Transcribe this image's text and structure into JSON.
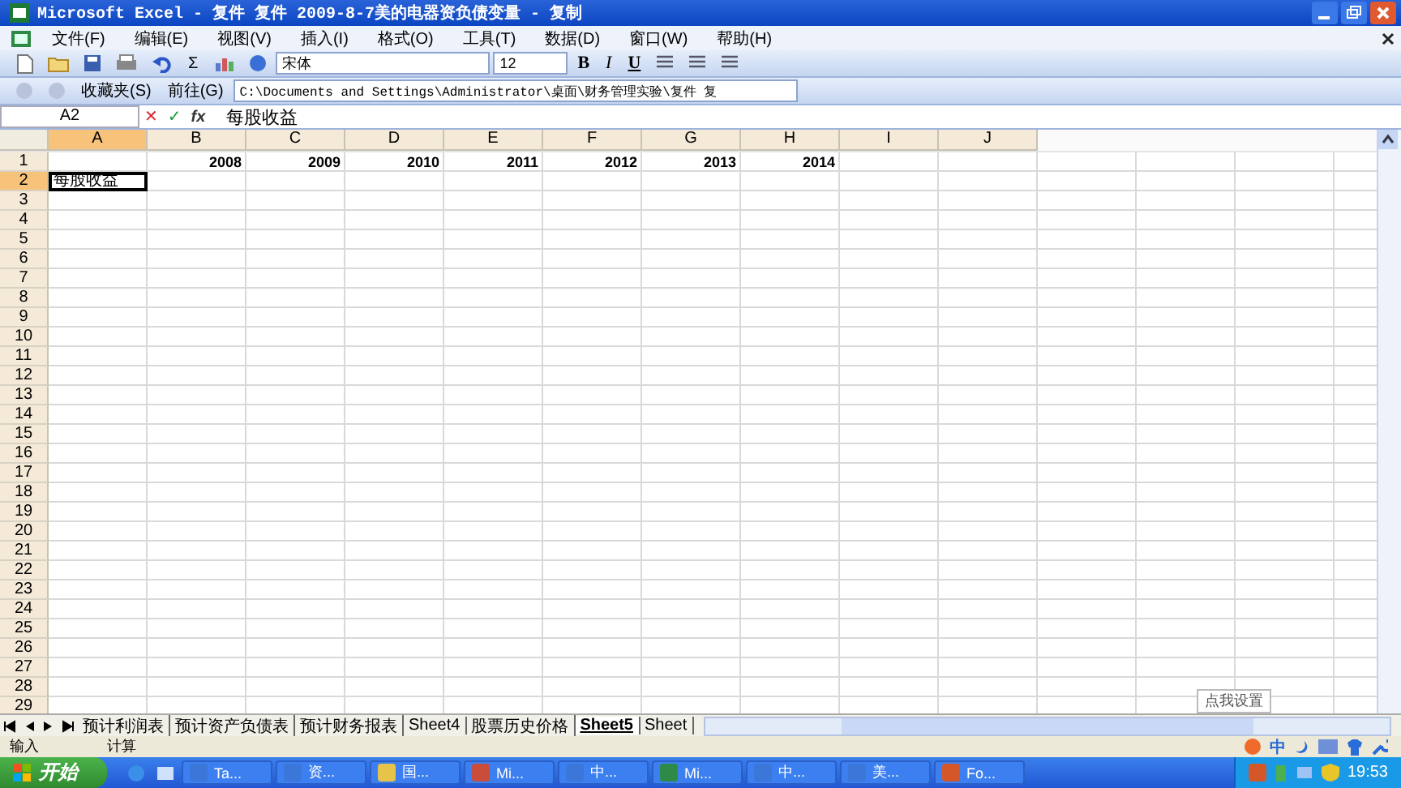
{
  "window": {
    "title": "Microsoft Excel - 复件 复件 2009-8-7美的电器资负债变量 - 复制"
  },
  "menu": [
    "文件(F)",
    "编辑(E)",
    "视图(V)",
    "插入(I)",
    "格式(O)",
    "工具(T)",
    "数据(D)",
    "窗口(W)",
    "帮助(H)"
  ],
  "formatting_toolbar": {
    "sum": "Σ",
    "font": "宋体",
    "size": "12",
    "bold": "B",
    "italic": "I",
    "underline": "U"
  },
  "web_toolbar": {
    "favorites": "收藏夹(S)",
    "go": "前往(G)",
    "address": "C:\\Documents and Settings\\Administrator\\桌面\\财务管理实验\\复件 复"
  },
  "formula_bar": {
    "name_box": "A2",
    "cancel": "✕",
    "enter": "✓",
    "fx": "fx",
    "value": "每股收益"
  },
  "columns": [
    {
      "label": "A",
      "selected": true
    },
    {
      "label": "B",
      "selected": false
    },
    {
      "label": "C",
      "selected": false
    },
    {
      "label": "D",
      "selected": false
    },
    {
      "label": "E",
      "selected": false
    },
    {
      "label": "F",
      "selected": false
    },
    {
      "label": "G",
      "selected": false
    },
    {
      "label": "H",
      "selected": false
    },
    {
      "label": "I",
      "selected": false
    },
    {
      "label": "J",
      "selected": false
    }
  ],
  "rows": [
    {
      "label": "1",
      "selected": false,
      "cells": [
        null,
        "2008",
        "2009",
        "2010",
        "2011",
        "2012",
        "2013",
        "2014",
        null,
        null
      ]
    },
    {
      "label": "2",
      "selected": true,
      "cells": [
        "每股收益",
        null,
        null,
        null,
        null,
        null,
        null,
        null,
        null,
        null
      ]
    },
    {
      "label": "3",
      "selected": false
    },
    {
      "label": "4",
      "selected": false
    },
    {
      "label": "5",
      "selected": false
    },
    {
      "label": "6",
      "selected": false
    },
    {
      "label": "7",
      "selected": false
    },
    {
      "label": "8",
      "selected": false
    },
    {
      "label": "9",
      "selected": false
    },
    {
      "label": "10",
      "selected": false
    },
    {
      "label": "11",
      "selected": false
    },
    {
      "label": "12",
      "selected": false
    },
    {
      "label": "13",
      "selected": false
    },
    {
      "label": "14",
      "selected": false
    },
    {
      "label": "15",
      "selected": false
    },
    {
      "label": "16",
      "selected": false
    },
    {
      "label": "17",
      "selected": false
    },
    {
      "label": "18",
      "selected": false
    },
    {
      "label": "19",
      "selected": false
    },
    {
      "label": "20",
      "selected": false
    },
    {
      "label": "21",
      "selected": false
    },
    {
      "label": "22",
      "selected": false
    },
    {
      "label": "23",
      "selected": false
    },
    {
      "label": "24",
      "selected": false
    },
    {
      "label": "25",
      "selected": false
    },
    {
      "label": "26",
      "selected": false
    },
    {
      "label": "27",
      "selected": false
    },
    {
      "label": "28",
      "selected": false
    },
    {
      "label": "29",
      "selected": false
    }
  ],
  "sheet_tabs": [
    {
      "label": "预计利润表",
      "selected": false
    },
    {
      "label": "预计资产负债表",
      "selected": false
    },
    {
      "label": "预计财务报表",
      "selected": false
    },
    {
      "label": "Sheet4",
      "selected": false
    },
    {
      "label": "股票历史价格",
      "selected": false
    },
    {
      "label": "Sheet5",
      "selected": true
    },
    {
      "label": "Sheet",
      "selected": false
    }
  ],
  "tooltip": "点我设置",
  "status_bar": [
    "输入",
    "计算"
  ],
  "ime_bar": {
    "mode": "中"
  },
  "taskbar": {
    "start": "开始",
    "tasks": [
      "Ta...",
      "资...",
      "国...",
      "Mi...",
      "中...",
      "Mi...",
      "中...",
      "美...",
      "Fo..."
    ],
    "clock": "19:53"
  }
}
